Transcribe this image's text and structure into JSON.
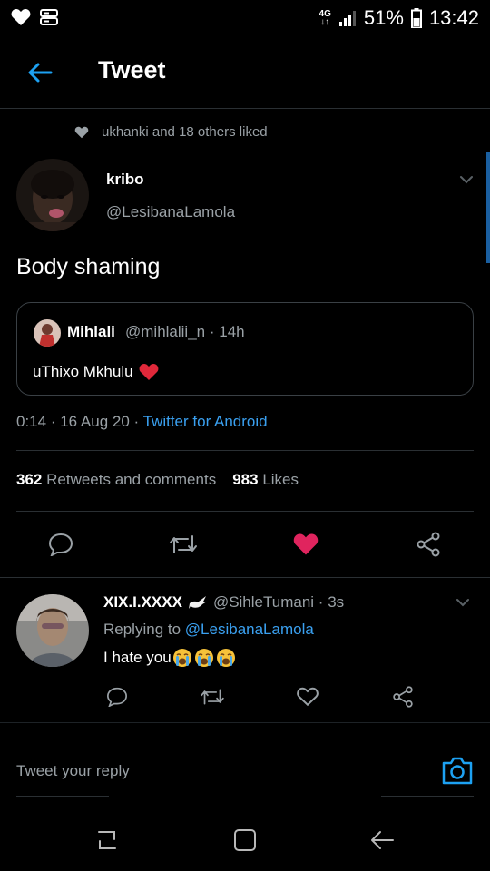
{
  "status_bar": {
    "network": "4G",
    "battery": "51%",
    "time": "13:42"
  },
  "header": {
    "title": "Tweet"
  },
  "social_context": {
    "text": "ukhanki and 18 others liked"
  },
  "tweet": {
    "author_name": "kribo",
    "author_handle": "@LesibanaLamola",
    "text": "Body shaming",
    "quoted": {
      "author_name": "Mihlali",
      "author_handle": "@mihlalii_n",
      "age": "14h",
      "text": "uThixo Mkhulu"
    },
    "time": "0:14",
    "date": "16 Aug 20",
    "source": "Twitter for Android",
    "retweets_count": "362",
    "retweets_label": "Retweets and comments",
    "likes_count": "983",
    "likes_label": "Likes",
    "liked": true
  },
  "reply": {
    "author_name": "XIX.I.XXXX",
    "author_handle": "@SihleTumani",
    "age": "3s",
    "replying_label": "Replying to",
    "replying_to": "@LesibanaLamola",
    "text": "I hate you",
    "emoji_count": 3
  },
  "composer": {
    "placeholder": "Tweet your reply"
  },
  "colors": {
    "accent": "#1DA1F2",
    "like": "#E0245E",
    "background": "#000000",
    "muted_text": "#9aa1a6"
  },
  "icons": [
    "heart-icon",
    "back-arrow-icon",
    "caret-down-icon",
    "reply-icon",
    "retweet-icon",
    "like-icon",
    "share-icon",
    "camera-icon",
    "recent-apps-icon",
    "home-icon",
    "back-nav-icon"
  ]
}
